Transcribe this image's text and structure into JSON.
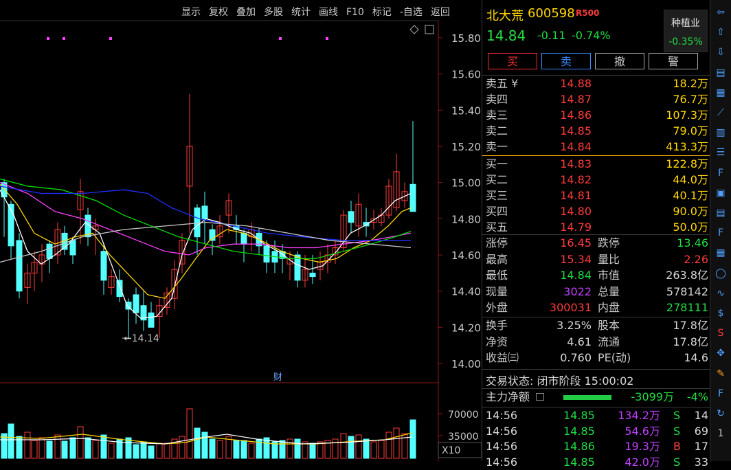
{
  "toolbar": [
    "显示",
    "复权",
    "叠加",
    "多股",
    "统计",
    "画线",
    "F10",
    "标记",
    "-自选",
    "返回"
  ],
  "chart": {
    "y_ticks": [
      "15.80",
      "15.60",
      "15.40",
      "15.20",
      "15.00",
      "14.80",
      "14.60",
      "14.40",
      "14.20",
      "14.00"
    ],
    "low_label": "←14.14",
    "cai_label": "财",
    "vol_ticks": [
      "70000",
      "35000"
    ],
    "vol_unit": "X10"
  },
  "stock": {
    "name": "北大荒",
    "code": "600598",
    "r_mark": "R500",
    "price": "14.84",
    "change": "-0.11",
    "change_pct": "-0.74%",
    "sector_name": "种植业",
    "sector_pct": "-0.35%"
  },
  "trade_buttons": [
    "买",
    "卖",
    "撤",
    "警"
  ],
  "asks": [
    {
      "label": "卖五 ¥",
      "price": "14.88",
      "vol": "18.2万"
    },
    {
      "label": "卖四",
      "price": "14.87",
      "vol": "76.7万"
    },
    {
      "label": "卖三",
      "price": "14.86",
      "vol": "107.3万"
    },
    {
      "label": "卖二",
      "price": "14.85",
      "vol": "79.0万"
    },
    {
      "label": "卖一",
      "price": "14.84",
      "vol": "413.3万"
    }
  ],
  "bids": [
    {
      "label": "买一",
      "price": "14.83",
      "vol": "122.8万"
    },
    {
      "label": "买二",
      "price": "14.82",
      "vol": "44.0万"
    },
    {
      "label": "买三",
      "price": "14.81",
      "vol": "40.1万"
    },
    {
      "label": "买四",
      "price": "14.80",
      "vol": "90.0万"
    },
    {
      "label": "买五",
      "price": "14.79",
      "vol": "50.0万"
    }
  ],
  "stats1": [
    {
      "l1": "涨停",
      "v1": "16.45",
      "c1": "red",
      "l2": "跌停",
      "v2": "13.46",
      "c2": "green"
    },
    {
      "l1": "最高",
      "v1": "15.34",
      "c1": "red",
      "l2": "量比",
      "v2": "2.26",
      "c2": "red"
    },
    {
      "l1": "最低",
      "v1": "14.84",
      "c1": "green",
      "l2": "市值",
      "v2": "263.8亿",
      "c2": "white"
    },
    {
      "l1": "现量",
      "v1": "3022",
      "c1": "purple",
      "l2": "总量",
      "v2": "578142",
      "c2": "white"
    },
    {
      "l1": "外盘",
      "v1": "300031",
      "c1": "red",
      "l2": "内盘",
      "v2": "278111",
      "c2": "green"
    }
  ],
  "stats2": [
    {
      "l1": "换手",
      "v1": "3.25%",
      "c1": "white",
      "l2": "股本",
      "v2": "17.8亿",
      "c2": "white"
    },
    {
      "l1": "净资",
      "v1": "4.61",
      "c1": "white",
      "l2": "流通",
      "v2": "17.8亿",
      "c2": "white"
    },
    {
      "l1": "收益㈢",
      "v1": "0.760",
      "c1": "white",
      "l2": "PE(动)",
      "v2": "14.6",
      "c2": "white"
    }
  ],
  "status_line": "交易状态: 闭市阶段 15:00:02",
  "main_flow": {
    "label": "主力净额",
    "amount": "-3099万",
    "pct": "-4%"
  },
  "ticks": [
    {
      "time": "14:56",
      "price": "14.85",
      "vol": "134.2万",
      "side": "S",
      "n": "14"
    },
    {
      "time": "14:56",
      "price": "14.85",
      "vol": "54.6万",
      "side": "S",
      "n": "69"
    },
    {
      "time": "14:56",
      "price": "14.86",
      "vol": "19.3万",
      "side": "B",
      "n": "17"
    },
    {
      "time": "14:56",
      "price": "14.85",
      "vol": "42.0万",
      "side": "S",
      "n": "33"
    }
  ],
  "sidebar_icons": [
    "arrow-left-icon",
    "arrow-up-icon",
    "arrow-down-icon",
    "kline-icon",
    "grid-icon",
    "line-chart-icon",
    "candle-icon",
    "list-icon",
    "f10-icon",
    "report-icon",
    "news-icon",
    "f12-icon",
    "stats-icon",
    "circle-icon",
    "wave-icon",
    "money-icon",
    "dollar-icon",
    "cross-icon",
    "pencil-icon",
    "f5-icon",
    "refresh-icon",
    "page-one-icon"
  ],
  "colors": {
    "up": "#ff3b3b",
    "down": "#22dd44",
    "k_down": "#54ffff",
    "ma5": "#ffffff",
    "ma10": "#ffd700",
    "ma20": "#ff40ff",
    "ma30": "#00dd00",
    "ma60": "#2030ff",
    "ma120": "#c8c8c8"
  }
}
